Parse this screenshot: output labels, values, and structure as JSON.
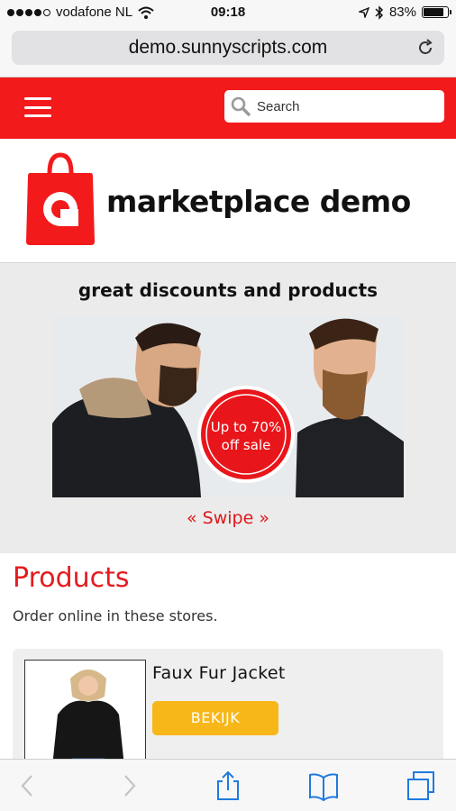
{
  "status_bar": {
    "carrier": "vodafone NL",
    "time": "09:18",
    "battery": "83%",
    "battery_level": 0.83,
    "signal_bars": 4
  },
  "browser": {
    "url": "demo.sunnyscripts.com"
  },
  "header": {
    "search_placeholder": "Search"
  },
  "logo": {
    "text": "marketplace demo"
  },
  "promo": {
    "title": "great discounts and products",
    "badge_line1": "Up to 70%",
    "badge_line2": "off sale",
    "swipe_label": "« Swipe »"
  },
  "products": {
    "heading": "Products",
    "subtitle": "Order online in these stores.",
    "items": [
      {
        "name": "Faux Fur Jacket",
        "button": "BEKIJK"
      }
    ]
  },
  "colors": {
    "brand_red": "#f31a1c",
    "button_yellow": "#f7b719",
    "ios_blue": "#1f7ae0"
  },
  "icons": [
    "wifi-icon",
    "location-icon",
    "bluetooth-icon",
    "battery-icon",
    "reload-icon",
    "menu-icon",
    "search-icon",
    "shopping-bag-icon",
    "back-icon",
    "forward-icon",
    "share-icon",
    "bookmarks-icon",
    "tabs-icon"
  ]
}
